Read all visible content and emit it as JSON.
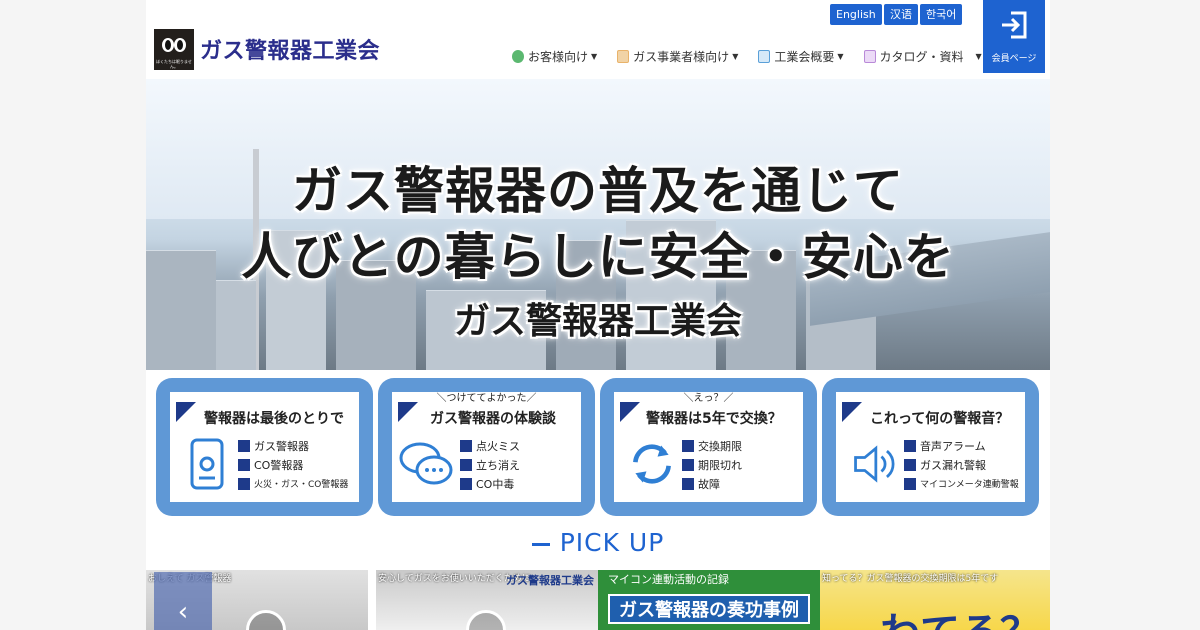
{
  "header": {
    "site_title": "ガス警報器工業会",
    "logo_small_text": "ほくたちは眠りません。",
    "languages": [
      "English",
      "汉语",
      "한국어"
    ],
    "nav": [
      {
        "label": "お客様向け",
        "icon": "people-icon",
        "color": "#5bb870"
      },
      {
        "label": "ガス事業者様向け",
        "icon": "building-icon",
        "color": "#e9b36a"
      },
      {
        "label": "工業会概要",
        "icon": "clipboard-icon",
        "color": "#5aa0d8"
      },
      {
        "label": "カタログ・資料",
        "icon": "book-icon",
        "color": "#b98ad8"
      }
    ],
    "member_label": "会員ページ"
  },
  "hero": {
    "line1": "ガス警報器の普及を通じて",
    "line2": "人びとの暮らしに安全・安心を",
    "line3": "ガス警報器工業会"
  },
  "cards": [
    {
      "kicker": "",
      "title": "警報器は最後のとりで",
      "icon": "alarm-device-icon",
      "items": [
        "ガス警報器",
        "CO警報器",
        "火災・ガス・CO警報器"
      ]
    },
    {
      "kicker": "＼つけててよかった／",
      "title": "ガス警報器の体験談",
      "icon": "speech-bubbles-icon",
      "items": [
        "点火ミス",
        "立ち消え",
        "CO中毒"
      ]
    },
    {
      "kicker": "＼えっ？／",
      "title": "警報器は5年で交換？",
      "icon": "refresh-icon",
      "items": [
        "交換期限",
        "期限切れ",
        "故障"
      ]
    },
    {
      "kicker": "",
      "title": "これって何の警報音？",
      "icon": "speaker-icon",
      "items": [
        "音声アラーム",
        "ガス漏れ警報",
        "マイコンメータ連動警報"
      ]
    }
  ],
  "pickup": {
    "heading": "PICK UP",
    "items": [
      {
        "caption": "おしえて ガス警報器"
      },
      {
        "caption": "安心してガスをお使いいただくために",
        "brand": "ガス警報器工業会"
      },
      {
        "caption": "ガス警報器の奏功事例",
        "sub": "マイコン連動活動の記録"
      },
      {
        "caption": "知ってる？ガス警報器の交換期限は5年です",
        "big": "わてる？"
      }
    ]
  },
  "colors": {
    "accent": "#1e63d0",
    "navy": "#1e3a8a",
    "card_frame": "#5f98d6"
  }
}
